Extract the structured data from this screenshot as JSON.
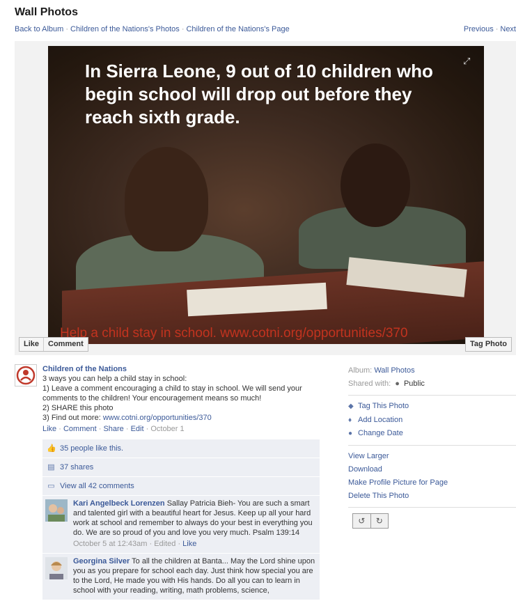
{
  "header": {
    "title": "Wall Photos",
    "breadcrumbs": [
      "Back to Album",
      "Children of the Nations's Photos",
      "Children of the Nations's Page"
    ],
    "previous_label": "Previous",
    "next_label": "Next"
  },
  "photo": {
    "headline": "In Sierra Leone, 9 out of 10 children who begin school will drop out before they reach sixth grade.",
    "footer_text": "Help a child stay in school. www.cotni.org/opportunities/370",
    "like_label": "Like",
    "comment_label": "Comment",
    "tag_photo_label": "Tag Photo"
  },
  "post": {
    "author": "Children of the Nations",
    "lines": [
      "3 ways you can help a child stay in school:",
      "1) Leave a comment encouraging a child to stay in school. We will send your comments to the children! Your encouragement means so much!",
      "2) SHARE this photo",
      "3) Find out more: "
    ],
    "link": "www.cotni.org/opportunities/370",
    "actions": {
      "like": "Like",
      "comment": "Comment",
      "share": "Share",
      "edit": "Edit",
      "date": "October 1"
    }
  },
  "ufi": {
    "likes": "35 people like this.",
    "shares": "37 shares",
    "view_comments": "View all 42 comments",
    "comments": [
      {
        "name": "Kari Angelbeck Lorenzen",
        "text": "Sallay Patricia Bieh- You are such a smart and talented girl with a beautiful heart for Jesus. Keep up all your hard work at school and remember to always do your best in everything you do. We are so proud of you and love you very much. Psalm 139:14",
        "time": "October 5 at 12:43am",
        "edited": "Edited",
        "like": "Like"
      },
      {
        "name": "Georgina Silver",
        "text": "To all the children at Banta... May the Lord shine upon you as you prepare for school each day. Just think how special you are to the Lord, He made you with His hands. Do all you can to learn in school with your reading, writing, math problems, science,",
        "time": "",
        "edited": "",
        "like": ""
      }
    ]
  },
  "sidebar": {
    "album_label": "Album:",
    "album_value": "Wall Photos",
    "shared_label": "Shared with:",
    "shared_value": "Public",
    "actions": [
      "Tag This Photo",
      "Add Location",
      "Change Date"
    ],
    "links": [
      "View Larger",
      "Download",
      "Make Profile Picture for Page",
      "Delete This Photo"
    ]
  },
  "colors": {
    "link": "#3b5998",
    "ufi_bg": "#edeff4",
    "footer_text": "#c2331f"
  }
}
